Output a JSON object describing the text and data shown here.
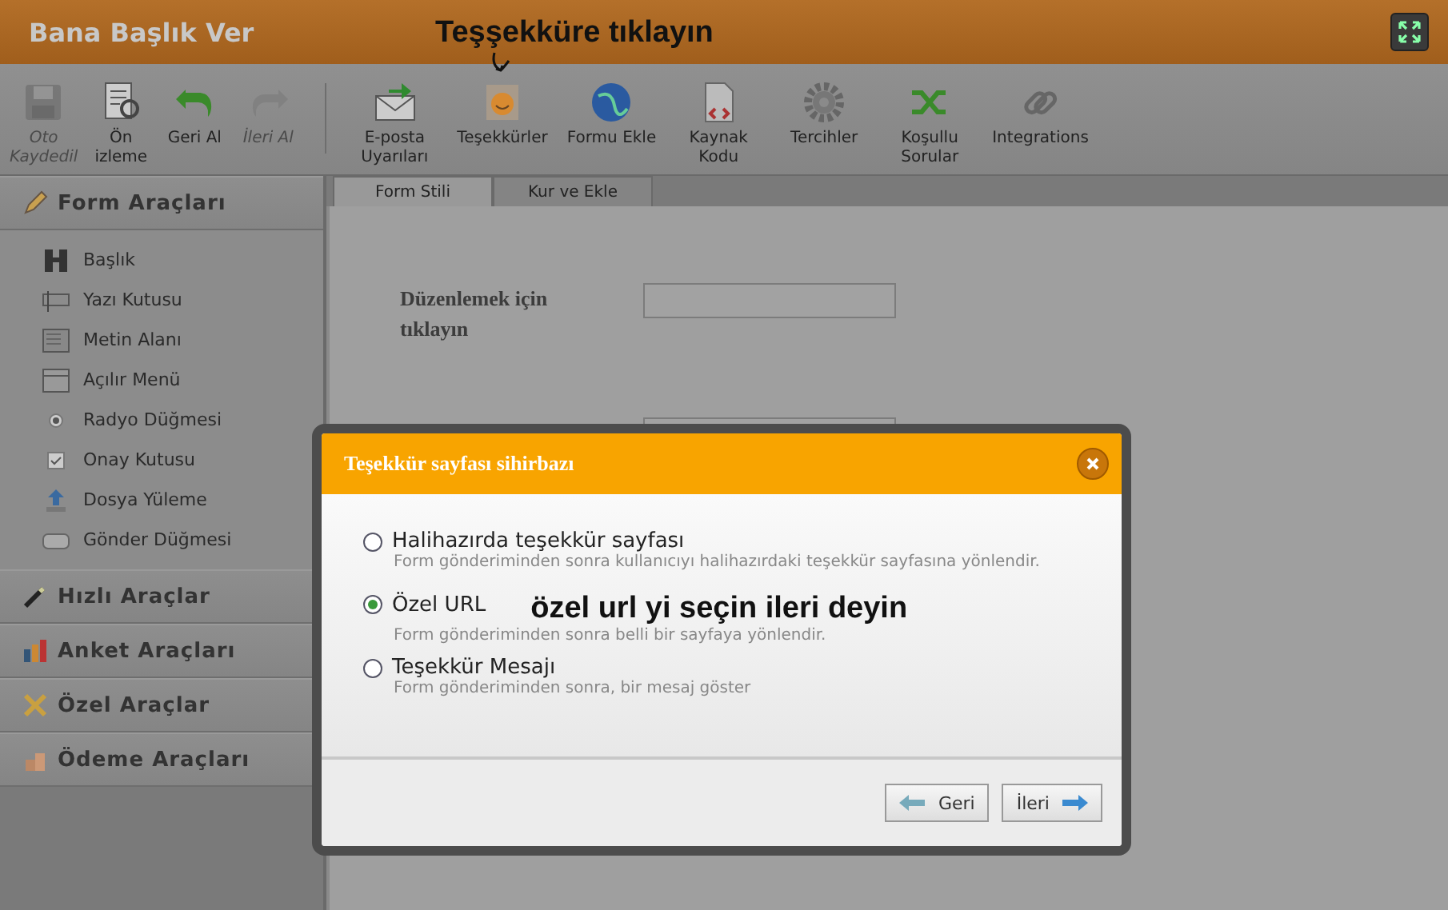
{
  "window": {
    "title": "Bana Başlık Ver"
  },
  "annotations": [
    {
      "kind": "top",
      "text": "Teşşekküre tıklayın"
    },
    {
      "kind": "dialog",
      "text": "özel url yi seçin ileri deyin"
    }
  ],
  "toolbar": [
    {
      "label": "Oto\nKaydedil",
      "disabled": true
    },
    {
      "label": "Ön\nizleme",
      "disabled": false
    },
    {
      "label": "Geri Al",
      "disabled": false
    },
    {
      "label": "İleri Al",
      "disabled": true
    },
    {
      "label": "E-posta\nUyarıları",
      "disabled": false
    },
    {
      "label": "Teşekkürler",
      "disabled": false
    },
    {
      "label": "Formu Ekle",
      "disabled": false
    },
    {
      "label": "Kaynak\nKodu",
      "disabled": false
    },
    {
      "label": "Tercihler",
      "disabled": false
    },
    {
      "label": "Koşullu\nSorular",
      "disabled": false
    },
    {
      "label": "Integrations",
      "disabled": false
    }
  ],
  "sidebar": {
    "sections": [
      {
        "title": "Form Araçları",
        "expanded": true,
        "items": [
          {
            "label": "Başlık"
          },
          {
            "label": "Yazı Kutusu"
          },
          {
            "label": "Metin Alanı"
          },
          {
            "label": "Açılır Menü"
          },
          {
            "label": "Radyo Düğmesi"
          },
          {
            "label": "Onay Kutusu"
          },
          {
            "label": "Dosya Yüleme"
          },
          {
            "label": "Gönder Düğmesi"
          }
        ]
      },
      {
        "title": "Hızlı Araçlar",
        "expanded": false
      },
      {
        "title": "Anket Araçları",
        "expanded": false
      },
      {
        "title": "Özel Araçlar",
        "expanded": false
      },
      {
        "title": "Ödeme Araçları",
        "expanded": false
      }
    ]
  },
  "tabs": [
    {
      "label": "Form Stili",
      "selected": true
    },
    {
      "label": "Kur ve Ekle",
      "selected": false
    }
  ],
  "form": {
    "field_label": "Düzenlemek için tıklayın"
  },
  "dialog": {
    "title": "Teşekkür sayfası sihirbazı",
    "options": [
      {
        "label": "Halihazırda teşekkür sayfası",
        "description": "Form gönderiminden sonra kullanıcıyı halihazırdaki teşekkür sayfasına yönlendir.",
        "selected": false
      },
      {
        "label": "Özel URL",
        "description": "Form gönderiminden sonra belli bir sayfaya yönlendir.",
        "selected": true
      },
      {
        "label": "Teşekkür Mesajı",
        "description": "Form gönderiminden sonra, bir mesaj göster",
        "selected": false
      }
    ],
    "buttons": [
      {
        "kind": "back",
        "label": "Geri"
      },
      {
        "kind": "next",
        "label": "İleri"
      }
    ]
  }
}
